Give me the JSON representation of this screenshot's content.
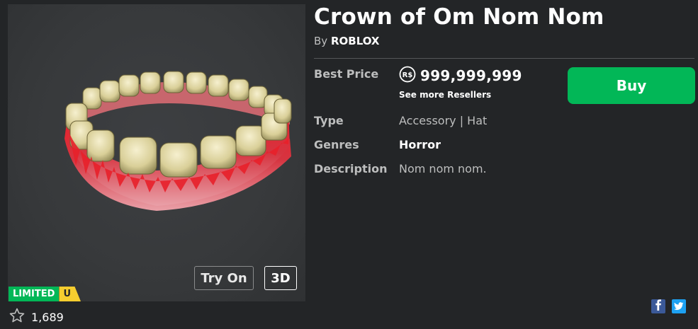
{
  "item": {
    "title": "Crown of Om Nom Nom",
    "by_prefix": "By",
    "creator": "ROBLOX",
    "badge_limited": "LIMITED",
    "badge_unique": "U",
    "favorites": "1,689"
  },
  "viewer": {
    "try_on_label": "Try On",
    "three_d_label": "3D"
  },
  "details": {
    "best_price_label": "Best Price",
    "currency_symbol": "R$",
    "price": "999,999,999",
    "see_more_resellers": "See more Resellers",
    "type_label": "Type",
    "type_value": "Accessory | Hat",
    "genres_label": "Genres",
    "genres_value": "Horror",
    "description_label": "Description",
    "description_value": "Nom nom nom."
  },
  "actions": {
    "buy_label": "Buy"
  },
  "colors": {
    "background": "#232527",
    "buy_green": "#02b757",
    "limited_green": "#02b757",
    "unique_yellow": "#f5cd2f",
    "facebook": "#3b5998",
    "twitter": "#1da1f2"
  },
  "icons": {
    "favorite": "star-outline-icon",
    "currency": "robux-icon",
    "facebook": "facebook-icon",
    "twitter": "twitter-icon"
  }
}
